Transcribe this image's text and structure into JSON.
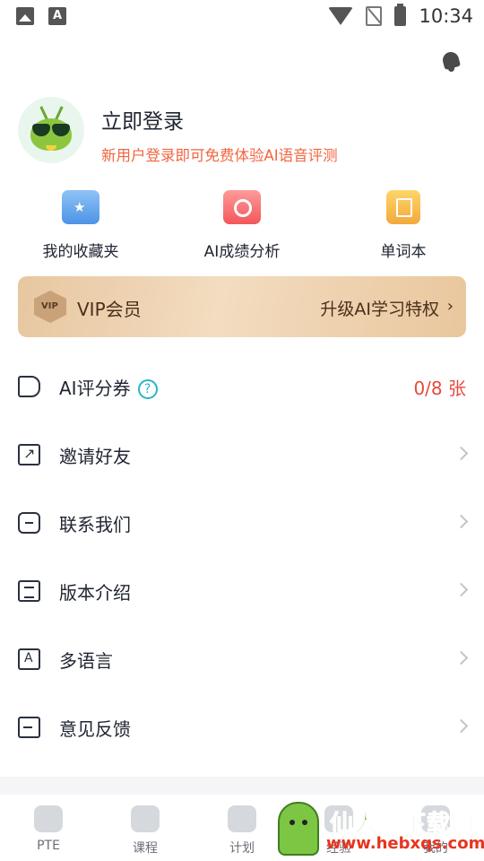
{
  "status_bar": {
    "time": "10:34",
    "left_icons": [
      "image-icon",
      "a-notification-icon"
    ],
    "right_icons": [
      "wifi-icon",
      "no-sim-icon",
      "battery-charging-icon"
    ],
    "a_glyph": "A"
  },
  "header": {
    "bell_icon": "bell-icon"
  },
  "profile": {
    "login_title": "立即登录",
    "login_subtitle": "新用户登录即可免费体验AI语音评测",
    "subtitle_color": "#f2653f"
  },
  "shortcuts": [
    {
      "label": "我的收藏夹",
      "icon": "favorites-folder-icon"
    },
    {
      "label": "AI成绩分析",
      "icon": "ai-analysis-icon"
    },
    {
      "label": "单词本",
      "icon": "wordbook-icon"
    }
  ],
  "vip": {
    "badge": "VIP",
    "title": "VIP会员",
    "cta": "升级AI学习特权",
    "chevron": "›"
  },
  "menu": {
    "ticket": {
      "label": "AI评分券",
      "help": "?",
      "count": "0/8 张",
      "count_color": "#e54b3c"
    },
    "items": [
      {
        "label": "邀请好友",
        "icon": "share-icon"
      },
      {
        "label": "联系我们",
        "icon": "message-icon"
      },
      {
        "label": "版本介绍",
        "icon": "document-icon"
      },
      {
        "label": "多语言",
        "icon": "language-icon"
      },
      {
        "label": "意见反馈",
        "icon": "feedback-icon"
      }
    ]
  },
  "tabbar": {
    "tabs": [
      {
        "label": "PTE",
        "icon": "headphones-icon"
      },
      {
        "label": "课程",
        "icon": "video-icon"
      },
      {
        "label": "计划",
        "icon": "plan-icon"
      },
      {
        "label": "经验",
        "icon": "experience-icon"
      },
      {
        "label": "我的",
        "icon": "profile-icon"
      }
    ]
  },
  "watermark": {
    "title": "仙人掌下载网",
    "url": "www.hebxqs.com"
  }
}
